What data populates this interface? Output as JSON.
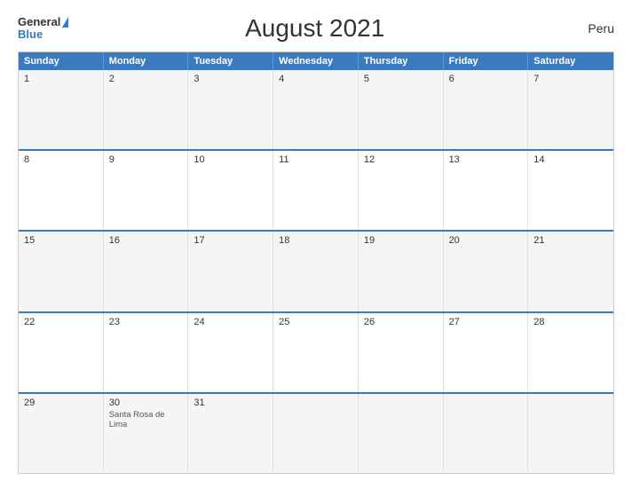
{
  "header": {
    "logo_general": "General",
    "logo_blue": "Blue",
    "title": "August 2021",
    "country": "Peru"
  },
  "calendar": {
    "days_of_week": [
      "Sunday",
      "Monday",
      "Tuesday",
      "Wednesday",
      "Thursday",
      "Friday",
      "Saturday"
    ],
    "weeks": [
      [
        {
          "day": "1",
          "holiday": ""
        },
        {
          "day": "2",
          "holiday": ""
        },
        {
          "day": "3",
          "holiday": ""
        },
        {
          "day": "4",
          "holiday": ""
        },
        {
          "day": "5",
          "holiday": ""
        },
        {
          "day": "6",
          "holiday": ""
        },
        {
          "day": "7",
          "holiday": ""
        }
      ],
      [
        {
          "day": "8",
          "holiday": ""
        },
        {
          "day": "9",
          "holiday": ""
        },
        {
          "day": "10",
          "holiday": ""
        },
        {
          "day": "11",
          "holiday": ""
        },
        {
          "day": "12",
          "holiday": ""
        },
        {
          "day": "13",
          "holiday": ""
        },
        {
          "day": "14",
          "holiday": ""
        }
      ],
      [
        {
          "day": "15",
          "holiday": ""
        },
        {
          "day": "16",
          "holiday": ""
        },
        {
          "day": "17",
          "holiday": ""
        },
        {
          "day": "18",
          "holiday": ""
        },
        {
          "day": "19",
          "holiday": ""
        },
        {
          "day": "20",
          "holiday": ""
        },
        {
          "day": "21",
          "holiday": ""
        }
      ],
      [
        {
          "day": "22",
          "holiday": ""
        },
        {
          "day": "23",
          "holiday": ""
        },
        {
          "day": "24",
          "holiday": ""
        },
        {
          "day": "25",
          "holiday": ""
        },
        {
          "day": "26",
          "holiday": ""
        },
        {
          "day": "27",
          "holiday": ""
        },
        {
          "day": "28",
          "holiday": ""
        }
      ],
      [
        {
          "day": "29",
          "holiday": ""
        },
        {
          "day": "30",
          "holiday": "Santa Rosa de Lima"
        },
        {
          "day": "31",
          "holiday": ""
        },
        {
          "day": "",
          "holiday": ""
        },
        {
          "day": "",
          "holiday": ""
        },
        {
          "day": "",
          "holiday": ""
        },
        {
          "day": "",
          "holiday": ""
        }
      ]
    ]
  }
}
